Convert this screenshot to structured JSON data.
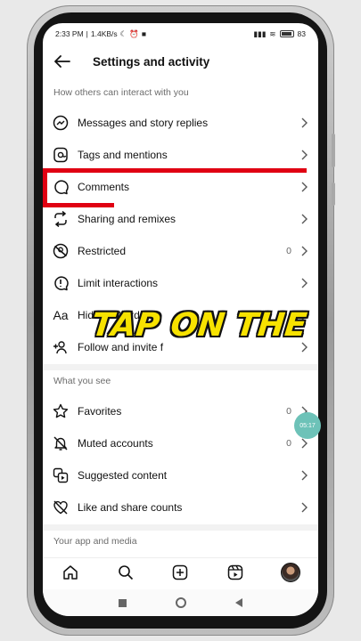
{
  "status": {
    "time": "2:33 PM",
    "speed": "1.4KB/s",
    "battery": "83"
  },
  "header": {
    "title": "Settings and activity"
  },
  "sections": {
    "interact": "How others can interact with you",
    "see": "What you see",
    "app": "Your app and media"
  },
  "items": {
    "messages": "Messages and story replies",
    "tags": "Tags and mentions",
    "comments": "Comments",
    "sharing": "Sharing and remixes",
    "restricted": "Restricted",
    "restricted_count": "0",
    "limit": "Limit interactions",
    "hidden": "Hidden Words",
    "follow": "Follow and invite f",
    "favorites": "Favorites",
    "favorites_count": "0",
    "muted": "Muted accounts",
    "muted_count": "0",
    "suggested": "Suggested content",
    "likeshare": "Like and share counts"
  },
  "overlay": {
    "caption": "TAP ON THE",
    "timer": "05:17"
  },
  "colors": {
    "highlight": "#e00012",
    "caption": "#f7e200",
    "timer": "#6dc2b8"
  }
}
